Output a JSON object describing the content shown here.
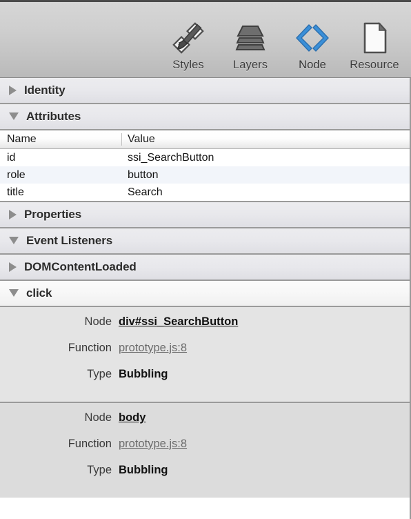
{
  "toolbar": {
    "tabs": [
      {
        "label": "Styles",
        "icon": "paintbrush-ruler-icon",
        "selected": false
      },
      {
        "label": "Layers",
        "icon": "layers-stack-icon",
        "selected": false
      },
      {
        "label": "Node",
        "icon": "angle-brackets-icon",
        "selected": true
      },
      {
        "label": "Resource",
        "icon": "document-page-icon",
        "selected": false
      }
    ],
    "accent_color": "#3a8fd8"
  },
  "sections": {
    "identity": {
      "title": "Identity",
      "expanded": false
    },
    "attributes": {
      "title": "Attributes",
      "expanded": true
    },
    "properties": {
      "title": "Properties",
      "expanded": false
    },
    "event_listeners": {
      "title": "Event Listeners",
      "expanded": true
    },
    "domcontentloaded": {
      "title": "DOMContentLoaded",
      "expanded": false
    },
    "click": {
      "title": "click",
      "expanded": true
    }
  },
  "attributes_table": {
    "columns": [
      "Name",
      "Value"
    ],
    "rows": [
      {
        "name": "id",
        "value": "ssi_SearchButton"
      },
      {
        "name": "role",
        "value": "button"
      },
      {
        "name": "title",
        "value": "Search"
      }
    ]
  },
  "click_listeners": [
    {
      "node_label": "Node",
      "node_value": "div#ssi_SearchButton",
      "function_label": "Function",
      "function_value": "prototype.js:8",
      "type_label": "Type",
      "type_value": "Bubbling"
    },
    {
      "node_label": "Node",
      "node_value": "body",
      "function_label": "Function",
      "function_value": "prototype.js:8",
      "type_label": "Type",
      "type_value": "Bubbling"
    }
  ]
}
